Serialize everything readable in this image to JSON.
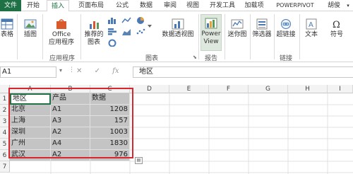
{
  "tabs": [
    "文件",
    "开始",
    "插入",
    "页面布局",
    "公式",
    "数据",
    "审阅",
    "视图",
    "开发工具",
    "加载项",
    "POWERPIVOT",
    "胡俊"
  ],
  "active_tab_index": 2,
  "ribbon": {
    "buttons": {
      "table": "表格",
      "illustrations": "插图",
      "office_apps": "Office\n应用程序",
      "recommended_charts": "推荐的\n图表",
      "pivot_chart": "数据透视图",
      "power_view": "Power\nView",
      "sparklines": "迷你图",
      "slicer": "筛选器",
      "hyperlink": "超链接",
      "text": "文本",
      "symbols": "符号"
    },
    "groups": {
      "apps": "应用程序",
      "charts": "图表",
      "reports": "报告",
      "links": "链接"
    }
  },
  "formula_bar": {
    "name_box": "A1",
    "fx": "fx",
    "content": "地区"
  },
  "grid": {
    "columns": [
      "A",
      "B",
      "C",
      "D",
      "E",
      "F",
      "G",
      "H",
      "I"
    ],
    "rows": [
      "1",
      "2",
      "3",
      "4",
      "5",
      "6",
      "7"
    ],
    "data": [
      [
        "地区",
        "产品",
        "数据"
      ],
      [
        "北京",
        "A1",
        "1208"
      ],
      [
        "上海",
        "A3",
        "157"
      ],
      [
        "深圳",
        "A2",
        "1003"
      ],
      [
        "广州",
        "A4",
        "1830"
      ],
      [
        "武汉",
        "A2",
        "976"
      ]
    ]
  },
  "colors": {
    "accent": "#217346",
    "file_tab": "#1e7145",
    "selection": "#c4c4c4",
    "highlight_box": "#d9262c"
  }
}
